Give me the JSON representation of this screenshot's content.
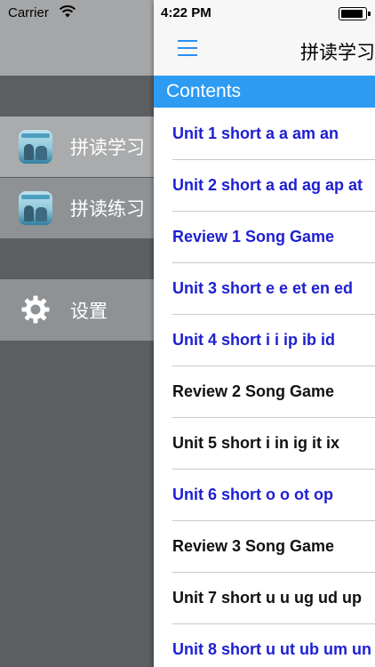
{
  "status": {
    "carrier": "Carrier",
    "time": "4:22 PM"
  },
  "sidebar": {
    "items": [
      {
        "label": "拼读学习",
        "icon": "app-icon"
      },
      {
        "label": "拼读练习",
        "icon": "app-icon"
      },
      {
        "label": "设置",
        "icon": "gear-icon"
      }
    ]
  },
  "navbar": {
    "title": "拼读学习",
    "menu_icon": "hamburger-icon"
  },
  "contents": {
    "title": "Contents",
    "items": [
      {
        "label": "Unit 1 short a a am an",
        "color": "#1d1fd1"
      },
      {
        "label": "Unit 2 short a ad ag ap at",
        "color": "#1d1fd1"
      },
      {
        "label": "Review 1 Song Game",
        "color": "#1d1fd1"
      },
      {
        "label": "Unit 3 short e e et en ed",
        "color": "#1d1fd1"
      },
      {
        "label": "Unit 4 short i i ip ib id",
        "color": "#1d1fd1"
      },
      {
        "label": "Review 2 Song Game",
        "color": "#111111"
      },
      {
        "label": "Unit 5 short i in ig it ix",
        "color": "#111111"
      },
      {
        "label": "Unit 6 short o o ot op",
        "color": "#1d1fd1"
      },
      {
        "label": "Review 3 Song Game",
        "color": "#111111"
      },
      {
        "label": "Unit 7 short u u ug ud up",
        "color": "#111111"
      },
      {
        "label": "Unit 8 short u ut ub um un",
        "color": "#1d1fd1"
      }
    ]
  },
  "colors": {
    "accent": "#2e9bf2",
    "link_blue": "#1d1fd1"
  }
}
